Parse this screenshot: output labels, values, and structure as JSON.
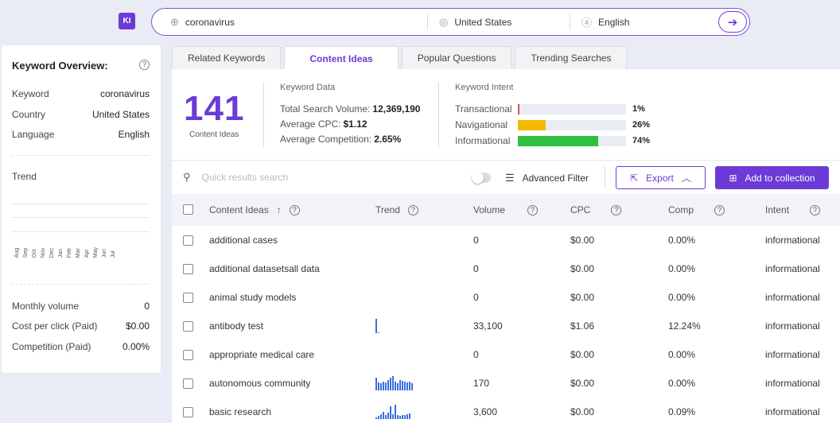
{
  "app": {
    "logo_text": "KI",
    "accent": "#6c3ad6"
  },
  "search": {
    "keyword": "coronavirus",
    "country": "United States",
    "language": "English"
  },
  "overview": {
    "title": "Keyword Overview:",
    "rows": [
      {
        "label": "Keyword",
        "value": "coronavirus"
      },
      {
        "label": "Country",
        "value": "United States"
      },
      {
        "label": "Language",
        "value": "English"
      }
    ],
    "trend_label": "Trend",
    "months": [
      "Aug",
      "Sep",
      "Oct",
      "Nov",
      "Dec",
      "Jan",
      "Feb",
      "Mar",
      "Apr",
      "May",
      "Jun",
      "Jul"
    ],
    "metrics": [
      {
        "label": "Monthly volume",
        "value": "0"
      },
      {
        "label": "Cost per click (Paid)",
        "value": "$0.00"
      },
      {
        "label": "Competition (Paid)",
        "value": "0.00%"
      }
    ]
  },
  "tabs": [
    {
      "label": "Related Keywords",
      "active": false
    },
    {
      "label": "Content Ideas",
      "active": true
    },
    {
      "label": "Popular Questions",
      "active": false
    },
    {
      "label": "Trending Searches",
      "active": false
    }
  ],
  "summary": {
    "count": "141",
    "count_label": "Content Ideas",
    "keyword_data_title": "Keyword Data",
    "total_volume_label": "Total Search Volume:",
    "total_volume": "12,369,190",
    "avg_cpc_label": "Average CPC:",
    "avg_cpc": "$1.12",
    "avg_comp_label": "Average Competition:",
    "avg_comp": "2.65%",
    "intent_title": "Keyword Intent",
    "intents": [
      {
        "name": "Transactional",
        "pct": "1%",
        "fraction": 0.01,
        "color": "#d9534f"
      },
      {
        "name": "Navigational",
        "pct": "26%",
        "fraction": 0.26,
        "color": "#f5b800"
      },
      {
        "name": "Informational",
        "pct": "74%",
        "fraction": 0.74,
        "color": "#2ec13f"
      }
    ]
  },
  "toolbar": {
    "search_placeholder": "Quick results search",
    "advanced_filter": "Advanced Filter",
    "export": "Export",
    "add_to_collection": "Add to collection"
  },
  "table": {
    "headers": {
      "idea": "Content Ideas",
      "trend": "Trend",
      "volume": "Volume",
      "cpc": "CPC",
      "comp": "Comp",
      "intent": "Intent"
    },
    "rows": [
      {
        "idea": "additional cases",
        "volume": "0",
        "cpc": "$0.00",
        "comp": "0.00%",
        "intent": "informational",
        "trend": []
      },
      {
        "idea": "additional datasetsall data",
        "volume": "0",
        "cpc": "$0.00",
        "comp": "0.00%",
        "intent": "informational",
        "trend": []
      },
      {
        "idea": "animal study models",
        "volume": "0",
        "cpc": "$0.00",
        "comp": "0.00%",
        "intent": "informational",
        "trend": []
      },
      {
        "idea": "antibody test",
        "volume": "33,100",
        "cpc": "$1.06",
        "comp": "12.24%",
        "intent": "informational",
        "trend": [
          1,
          0.08
        ]
      },
      {
        "idea": "appropriate medical care",
        "volume": "0",
        "cpc": "$0.00",
        "comp": "0.00%",
        "intent": "informational",
        "trend": []
      },
      {
        "idea": "autonomous community",
        "volume": "170",
        "cpc": "$0.00",
        "comp": "0.00%",
        "intent": "informational",
        "trend": [
          0.9,
          0.55,
          0.5,
          0.6,
          0.55,
          0.7,
          0.9,
          1,
          0.6,
          0.5,
          0.7,
          0.65,
          0.6,
          0.55,
          0.6,
          0.5
        ]
      },
      {
        "idea": "basic research",
        "volume": "3,600",
        "cpc": "$0.00",
        "comp": "0.09%",
        "intent": "informational",
        "trend": [
          0.1,
          0.2,
          0.35,
          0.5,
          0.3,
          0.45,
          0.9,
          0.35,
          1,
          0.3,
          0.2,
          0.3,
          0.25,
          0.35,
          0.4
        ]
      }
    ]
  }
}
